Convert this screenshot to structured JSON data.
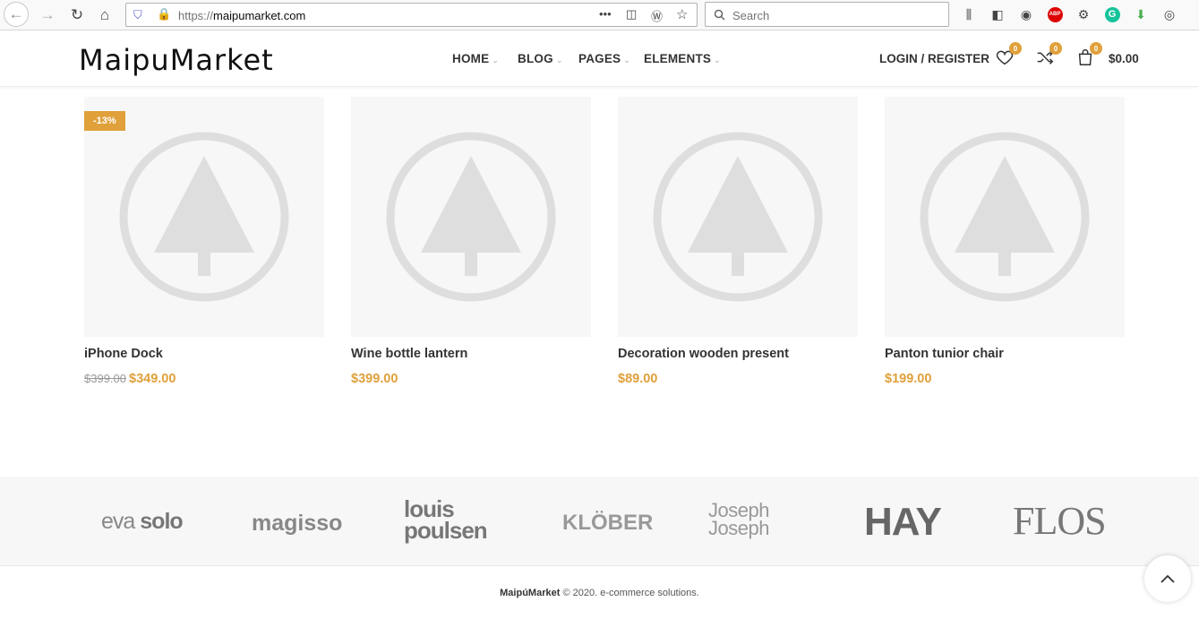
{
  "browser": {
    "url_proto": "https://",
    "url_host": "maipumarket.com",
    "search_placeholder": "Search"
  },
  "header": {
    "logo": "MaipuMarket",
    "menu": [
      {
        "label": "HOME"
      },
      {
        "label": "BLOG"
      },
      {
        "label": "PAGES"
      },
      {
        "label": "ELEMENTS"
      }
    ],
    "login_label": "LOGIN / REGISTER",
    "wishlist_count": "0",
    "compare_count": "0",
    "cart_count": "0",
    "cart_total": "$0.00"
  },
  "products": [
    {
      "name": "iPhone Dock",
      "old_price": "$399.00",
      "price": "$349.00",
      "badge": "-13%"
    },
    {
      "name": "Wine bottle lantern",
      "price": "$399.00"
    },
    {
      "name": "Decoration wooden present",
      "price": "$89.00"
    },
    {
      "name": "Panton tunior chair",
      "price": "$199.00"
    }
  ],
  "brands": [
    {
      "name": "eva solo",
      "part1": "eva",
      "part2": "solo"
    },
    {
      "name": "magisso"
    },
    {
      "name": "louis poulsen",
      "line1": "louis",
      "line2": "poulsen"
    },
    {
      "name": "KLÖBER"
    },
    {
      "name": "Joseph Joseph",
      "line1": "Joseph",
      "line2": "Joseph"
    },
    {
      "name": "HAY"
    },
    {
      "name": "FLOS"
    }
  ],
  "footer": {
    "brand": "MaipúMarket",
    "copyright": "© 2020. e-commerce solutions."
  },
  "colors": {
    "accent": "#e0a03a",
    "placeholder_grey": "#dedede"
  }
}
